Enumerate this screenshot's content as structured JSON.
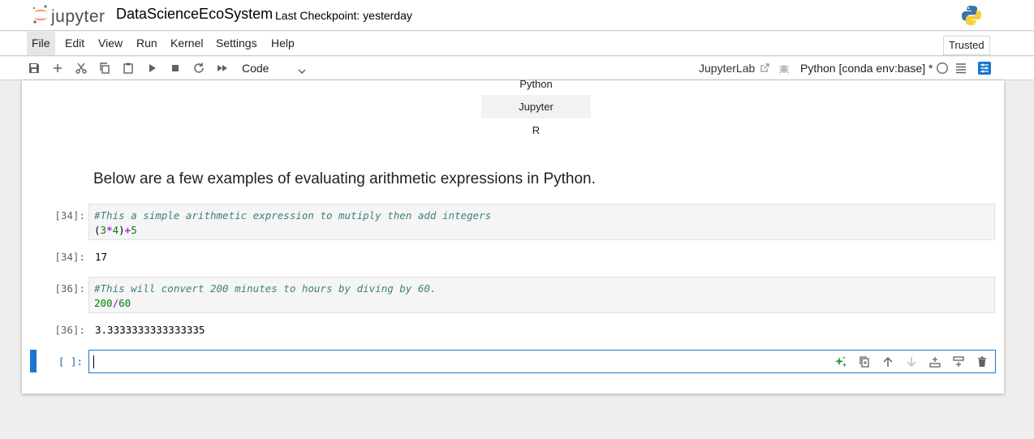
{
  "header": {
    "logo_text": "jupyter",
    "notebook_title": "DataScienceEcoSystem",
    "checkpoint": "Last Checkpoint: yesterday"
  },
  "menu": {
    "items": [
      "File",
      "Edit",
      "View",
      "Run",
      "Kernel",
      "Settings",
      "Help"
    ],
    "trusted": "Trusted"
  },
  "toolbar": {
    "cell_type": "Code",
    "jupyterlab": "JupyterLab",
    "kernel": "Python [conda env:base] *"
  },
  "notebook": {
    "table_rows": [
      "Python",
      "Jupyter",
      "R"
    ],
    "heading": "Below are a few examples of evaluating arithmetic expressions in Python.",
    "cells": [
      {
        "prompt": "[34]:",
        "comment": "#This a simple arithmetic expression to mutiply then add integers",
        "output_prompt": "[34]:",
        "output": "17"
      },
      {
        "prompt": "[36]:",
        "comment": "#This will convert 200 minutes to hours by diving by 60.",
        "output_prompt": "[36]:",
        "output": "3.3333333333333335"
      }
    ],
    "active_prompt": "[ ]:"
  },
  "colors": {
    "accent": "#1976d2",
    "comment": "#408080",
    "number": "#008000",
    "operator": "#aa22ff"
  }
}
